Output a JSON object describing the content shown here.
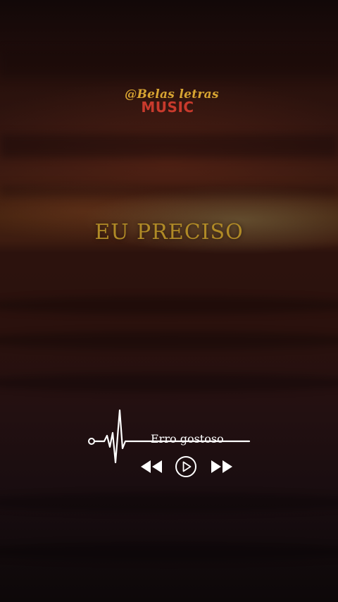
{
  "brand": {
    "handle": "@Belas letras",
    "name": "MUSIC",
    "handle_color": "#d8a532",
    "name_color": "#c83a2c"
  },
  "lyric": {
    "text": "EU PRECISO",
    "color": "#b08a26"
  },
  "player": {
    "track_title": "Erro gostoso",
    "icons": {
      "pulse": "heartbeat-line-icon",
      "rewind": "rewind-icon",
      "play": "play-icon",
      "forward": "fast-forward-icon"
    }
  }
}
